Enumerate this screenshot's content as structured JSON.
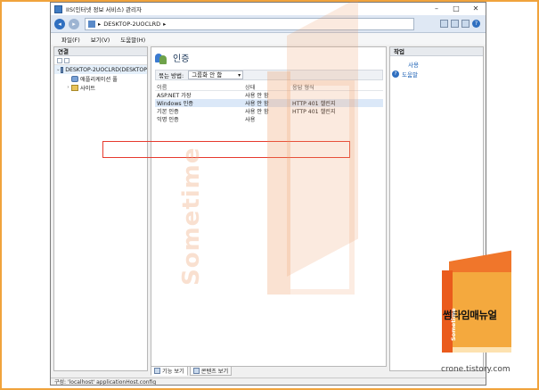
{
  "window": {
    "title": "IIS(인터넷 정보 서비스) 관리자",
    "controls": {
      "minimize": "–",
      "maximize": "□",
      "close": "✕"
    }
  },
  "address": {
    "path": "DESKTOP-2UOCLRD",
    "separator": "▸"
  },
  "menu": [
    "파일(F)",
    "보기(V)",
    "도움말(H)"
  ],
  "connections": {
    "header": "연결",
    "tree": [
      {
        "label": "DESKTOP-2UOCLRD(DESKTOP",
        "arrow": "⌄",
        "icon": "server-icon",
        "level": 0
      },
      {
        "label": "애플리케이션 풀",
        "arrow": "",
        "icon": "app-pool-icon",
        "level": 1
      },
      {
        "label": "사이트",
        "arrow": "›",
        "icon": "sites-icon",
        "level": 1
      }
    ]
  },
  "feature": {
    "title": "인증",
    "group_label": "묶는 방법:",
    "group_value": "그룹화 안 함",
    "columns": [
      "이름",
      "상태",
      "응답 형식"
    ],
    "rows": [
      {
        "name": "ASP.NET 가장",
        "state": "사용 안 함",
        "type": ""
      },
      {
        "name": "Windows 인증",
        "state": "사용 안 함",
        "type": "HTTP 401 챌린지"
      },
      {
        "name": "기본 인증",
        "state": "사용 안 함",
        "type": "HTTP 401 챌린지"
      },
      {
        "name": "익명 인증",
        "state": "사용",
        "type": ""
      }
    ]
  },
  "tabs": [
    {
      "label": "기능 보기",
      "active": true
    },
    {
      "label": "콘텐츠 보기",
      "active": false
    }
  ],
  "actions": {
    "header": "작업",
    "items": [
      {
        "label": "사용",
        "icon": ""
      },
      {
        "label": "도움말",
        "icon": "help-icon"
      }
    ]
  },
  "status": "구성: 'localhost' applicationHost.config",
  "watermark": {
    "text": "Sometime",
    "logo_text": "썸타임매뉴얼",
    "logo_vertical": "Sometime",
    "url": "crone.tistory.com"
  },
  "colors": {
    "highlight": "#e63a2e",
    "frame": "#f0a33c",
    "accent": "#2f6fc0"
  }
}
